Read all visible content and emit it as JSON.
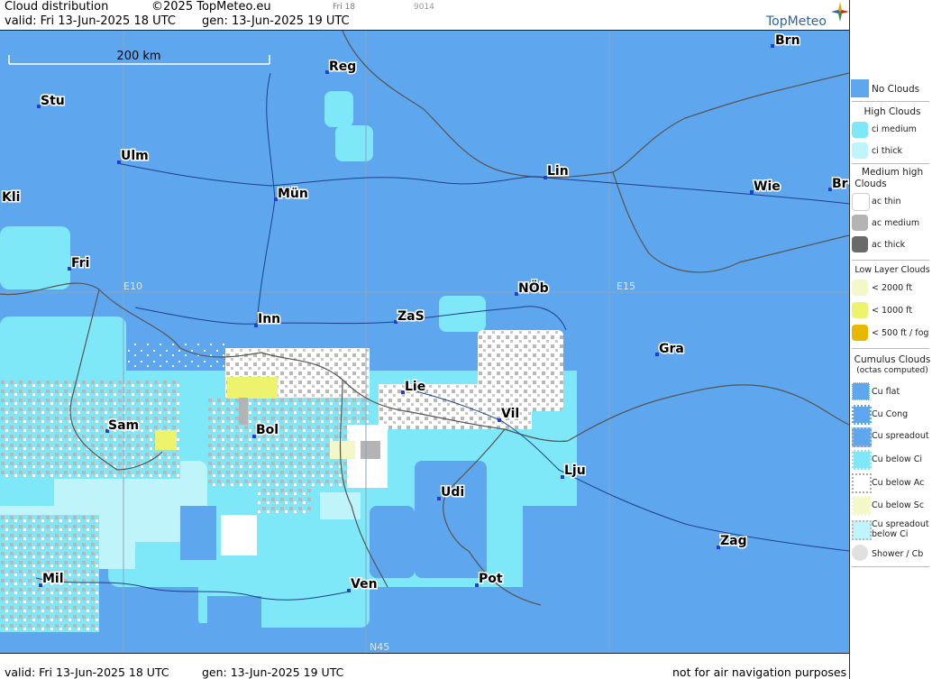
{
  "header": {
    "product": "Cloud distribution",
    "copyright": "©2025 TopMeteo.eu",
    "small_day": "Fri 18",
    "small_code": "9014",
    "valid": "valid:  Fri  13-Jun-2025  18 UTC",
    "gen": "gen: 13-Jun-2025 19 UTC",
    "brand": "TopMeteo"
  },
  "footer": {
    "valid": "valid:  Fri  13-Jun-2025  18 UTC",
    "gen": "gen: 13-Jun-2025 19 UTC",
    "disclaimer": "not for air navigation purposes"
  },
  "map": {
    "scale_label": "200 km",
    "grid_labels": [
      "E10",
      "E15",
      "N45"
    ],
    "cities": [
      {
        "name": "Brn"
      },
      {
        "name": "Reg"
      },
      {
        "name": "Stu"
      },
      {
        "name": "Ulm"
      },
      {
        "name": "Lin"
      },
      {
        "name": "Kli"
      },
      {
        "name": "Mün"
      },
      {
        "name": "Wie"
      },
      {
        "name": "Br"
      },
      {
        "name": "Fri"
      },
      {
        "name": "NÖb"
      },
      {
        "name": "Inn"
      },
      {
        "name": "ZaS"
      },
      {
        "name": "Gra"
      },
      {
        "name": "Lie"
      },
      {
        "name": "Sam"
      },
      {
        "name": "Vil"
      },
      {
        "name": "Bol"
      },
      {
        "name": "Lju"
      },
      {
        "name": "Udi"
      },
      {
        "name": "Zag"
      },
      {
        "name": "Mil"
      },
      {
        "name": "Pot"
      },
      {
        "name": "Ven"
      }
    ]
  },
  "legend": {
    "no_clouds": "No Clouds",
    "high_title": "High Clouds",
    "ci_medium": "ci medium",
    "ci_thick": "ci thick",
    "medium_title_1": "Medium high",
    "medium_title_2": "Clouds",
    "ac_thin": "ac thin",
    "ac_medium": "ac medium",
    "ac_thick": "ac thick",
    "low_title": "Low Layer Clouds",
    "low_2000": "< 2000 ft",
    "low_1000": "< 1000 ft",
    "low_500": "< 500 ft / fog",
    "cu_title": "Cumulus Clouds",
    "cu_sub": "(octas computed)",
    "cu_flat": "Cu flat",
    "cu_cong": "Cu Cong",
    "cu_spreadout": "Cu spreadout",
    "cu_below_ci": "Cu below Ci",
    "cu_below_ac": "Cu below Ac",
    "cu_below_sc": "Cu below Sc",
    "cu_spread_ci_1": "Cu spreadout",
    "cu_spread_ci_2": "below Ci",
    "shower": "Shower / Cb",
    "colors": {
      "no_clouds": "#5ea7ee",
      "ci_medium": "#7ee8f8",
      "ci_thick": "#bff4fb",
      "ac_thin": "#ffffff",
      "ac_medium": "#b4b4b4",
      "ac_thick": "#6a6a6a",
      "low_2000": "#f4f7c8",
      "low_1000": "#eef36e",
      "low_500": "#e8b800"
    }
  }
}
